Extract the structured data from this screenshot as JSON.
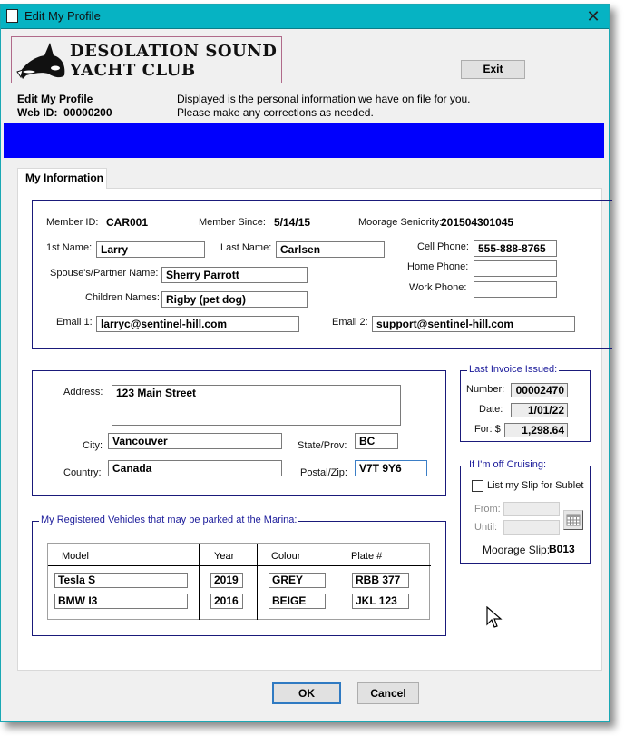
{
  "window": {
    "title": "Edit My Profile",
    "close_icon": "close-icon"
  },
  "logo": {
    "line1": "DESOLATION SOUND",
    "line2": "YACHT CLUB",
    "icon": "orca-icon"
  },
  "header": {
    "exit_label": "Exit",
    "page_title": "Edit My Profile",
    "web_id_label": "Web ID:",
    "web_id": "00000200",
    "info_line1": "Displayed is the personal information we have on file for you.",
    "info_line2": "Please make any corrections as needed.",
    "banner_color": "#0000fd"
  },
  "tabs": [
    {
      "label": "My Information",
      "active": true
    }
  ],
  "member": {
    "member_id_label": "Member ID:",
    "member_id": "CAR001",
    "member_since_label": "Member Since:",
    "member_since": "5/14/15",
    "seniority_label": "Moorage Seniority:",
    "seniority": "201504301045",
    "first_name_label": "1st Name:",
    "first_name": "Larry",
    "last_name_label": "Last Name:",
    "last_name": "Carlsen",
    "cell_label": "Cell Phone:",
    "cell": "555-888-8765",
    "home_label": "Home Phone:",
    "home": "",
    "work_label": "Work Phone:",
    "work": "",
    "spouse_label": "Spouse's/Partner Name:",
    "spouse": "Sherry Parrott",
    "children_label": "Children Names:",
    "children": "Rigby (pet dog)",
    "email1_label": "Email 1:",
    "email1": "larryc@sentinel-hill.com",
    "email2_label": "Email 2:",
    "email2": "support@sentinel-hill.com"
  },
  "address": {
    "address_label": "Address:",
    "address": "123 Main Street",
    "city_label": "City:",
    "city": "Vancouver",
    "state_label": "State/Prov:",
    "state": "BC",
    "country_label": "Country:",
    "country": "Canada",
    "postal_label": "Postal/Zip:",
    "postal": "V7T 9Y6"
  },
  "invoice": {
    "legend": "Last Invoice Issued:",
    "number_label": "Number:",
    "number": "00002470",
    "date_label": "Date:",
    "date": "1/01/22",
    "amount_label": "For: $",
    "amount": "1,298.64"
  },
  "cruising": {
    "legend": "If I'm off Cruising:",
    "sublet_label": "List my Slip for Sublet",
    "sublet_checked": false,
    "from_label": "From:",
    "from": "",
    "until_label": "Until:",
    "until": "",
    "calendar_icon": "calendar-icon",
    "slip_label": "Moorage Slip:",
    "slip": "B013"
  },
  "vehicles": {
    "legend": "My Registered Vehicles that may be parked at the Marina:",
    "columns": [
      "Model",
      "Year",
      "Colour",
      "Plate #"
    ],
    "rows": [
      {
        "model": "Tesla S",
        "year": "2019",
        "colour": "GREY",
        "plate": "RBB 377"
      },
      {
        "model": "BMW I3",
        "year": "2016",
        "colour": "BEIGE",
        "plate": "JKL 123"
      }
    ]
  },
  "footer": {
    "ok_label": "OK",
    "cancel_label": "Cancel"
  }
}
